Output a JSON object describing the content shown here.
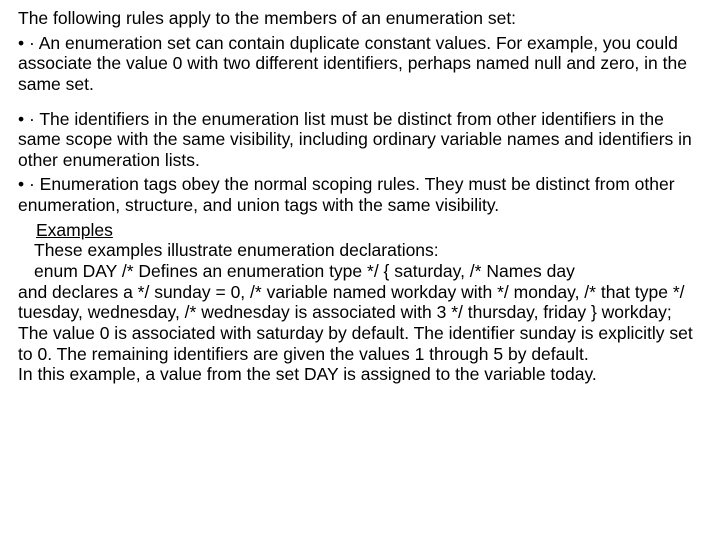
{
  "p1": "The following rules apply to the members of an enumeration set:",
  "p2": " • ·           An enumeration set can contain duplicate constant values. For example, you could associate the value 0 with two different identifiers, perhaps named null and zero, in the same set.",
  "p3": " • ·           The identifiers in the enumeration list must be distinct from other identifiers in the same scope with the same visibility, including ordinary variable names and identifiers in other enumeration lists.",
  "p4": " • ·           Enumeration tags obey the normal scoping rules. They must be distinct from other enumeration, structure, and union tags with the same visibility.",
  "examples_pre": "    ",
  "examples_word": "Examples",
  "p5": "These examples illustrate enumeration declarations:",
  "p6": "enum DAY /* Defines an enumeration type */ { saturday, /* Names day",
  "p7": "and declares a */ sunday = 0, /* variable named workday with */ monday, /* that type */ tuesday, wednesday, /* wednesday is associated with 3 */ thursday, friday } workday;",
  "p8": " The value 0 is associated with saturday by default. The identifier sunday is explicitly set to 0. The remaining identifiers are given the values 1 through 5 by default.",
  "p9": "In this example, a value from the set DAY is assigned to the variable today."
}
